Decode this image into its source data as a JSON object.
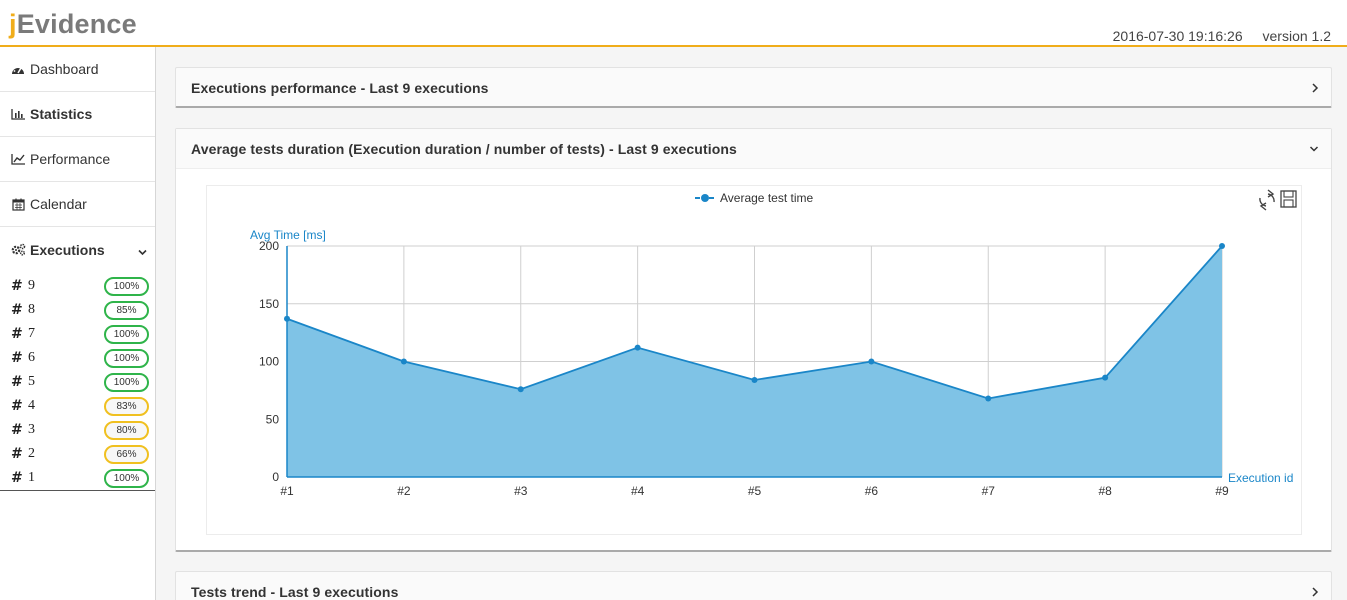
{
  "header": {
    "logo_j": "j",
    "logo_rest": "Evidence",
    "datetime": "2016-07-30 19:16:26",
    "version": "version 1.2"
  },
  "sidebar": {
    "items": [
      {
        "label": "Dashboard",
        "icon": "dashboard-icon"
      },
      {
        "label": "Statistics",
        "icon": "bar-chart-icon"
      },
      {
        "label": "Performance",
        "icon": "line-chart-icon"
      },
      {
        "label": "Calendar",
        "icon": "calendar-icon"
      },
      {
        "label": "Executions",
        "icon": "cogs-icon"
      }
    ],
    "executions": [
      {
        "hash": "#",
        "id": "9",
        "pct": "100%",
        "status": "ok"
      },
      {
        "hash": "#",
        "id": "8",
        "pct": "85%",
        "status": "ok"
      },
      {
        "hash": "#",
        "id": "7",
        "pct": "100%",
        "status": "ok"
      },
      {
        "hash": "#",
        "id": "6",
        "pct": "100%",
        "status": "ok"
      },
      {
        "hash": "#",
        "id": "5",
        "pct": "100%",
        "status": "ok"
      },
      {
        "hash": "#",
        "id": "4",
        "pct": "83%",
        "status": "warn"
      },
      {
        "hash": "#",
        "id": "3",
        "pct": "80%",
        "status": "warn"
      },
      {
        "hash": "#",
        "id": "2",
        "pct": "66%",
        "status": "warn"
      },
      {
        "hash": "#",
        "id": "1",
        "pct": "100%",
        "status": "ok"
      }
    ]
  },
  "panels": {
    "performance_title": "Executions performance - Last 9 executions",
    "avg_title": "Average tests duration (Execution duration / number of tests) - Last 9 executions",
    "trend_title": "Tests trend - Last 9 executions"
  },
  "colors": {
    "accent": "#f0ad1a",
    "series": "#1a86c8",
    "area": "#7fc3e6",
    "ok": "#2fb44a",
    "warn": "#f0c020"
  },
  "chart_data": {
    "type": "area",
    "legend": "Average test time",
    "legend_position": "top-center",
    "ylabel": "Avg Time [ms]",
    "xlabel": "Execution id",
    "ylim": [
      0,
      200
    ],
    "yticks": [
      0,
      50,
      100,
      150,
      200
    ],
    "categories": [
      "#1",
      "#2",
      "#3",
      "#4",
      "#5",
      "#6",
      "#7",
      "#8",
      "#9"
    ],
    "series": [
      {
        "name": "Average test time",
        "values": [
          137,
          100,
          76,
          112,
          84,
          100,
          68,
          86,
          200
        ]
      }
    ],
    "grid": true
  }
}
